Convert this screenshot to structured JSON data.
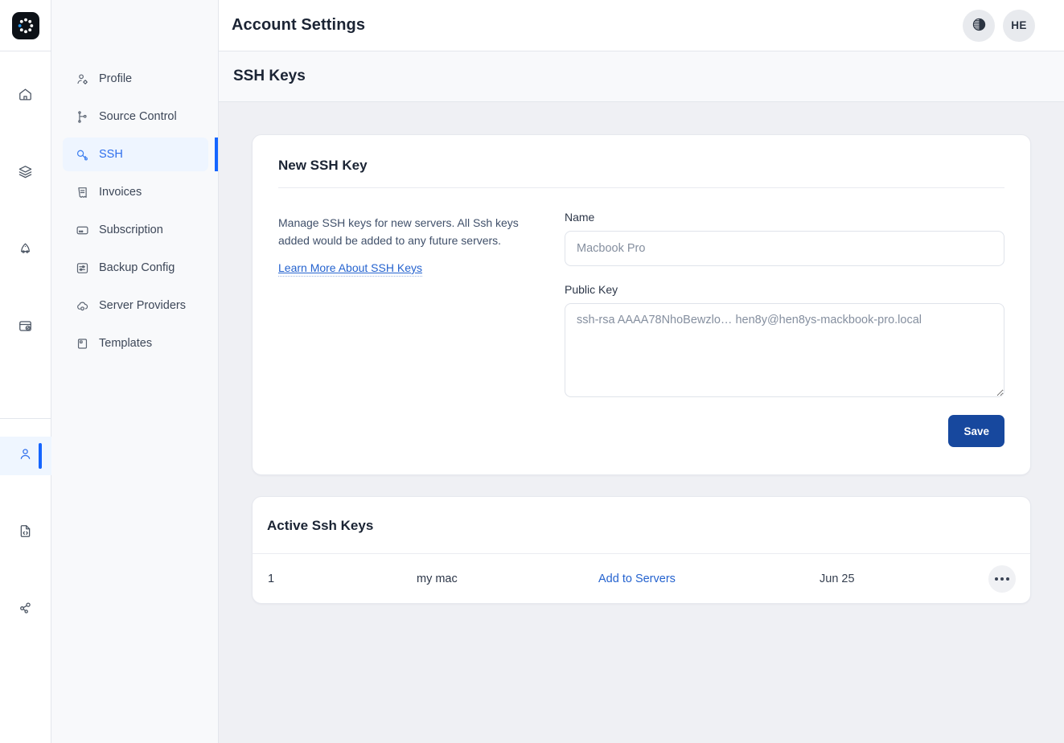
{
  "brand": {
    "logo_icon": "ring-of-dots-logo",
    "accent": "#1565ff",
    "accent_dark": "#17489e"
  },
  "topbar": {
    "title": "Account Settings",
    "theme_toggle_icon": "contrast-icon",
    "avatar_initials": "HE"
  },
  "rail": {
    "items": [
      {
        "name": "home",
        "icon": "home-icon",
        "active": false
      },
      {
        "name": "servers",
        "icon": "layers-icon",
        "active": false
      },
      {
        "name": "applications",
        "icon": "rocket-icon",
        "active": false
      },
      {
        "name": "backups",
        "icon": "database-check-icon",
        "active": false
      },
      {
        "name": "account",
        "icon": "user-icon",
        "active": true
      },
      {
        "name": "docs",
        "icon": "file-code-icon",
        "active": false
      },
      {
        "name": "integrations",
        "icon": "share-nodes-icon",
        "active": false
      }
    ]
  },
  "sidebar": {
    "items": [
      {
        "label": "Profile",
        "icon": "user-gear-icon",
        "active": false
      },
      {
        "label": "Source Control",
        "icon": "git-branch-icon",
        "active": false
      },
      {
        "label": "SSH",
        "icon": "key-icon",
        "active": true
      },
      {
        "label": "Invoices",
        "icon": "receipt-icon",
        "active": false
      },
      {
        "label": "Subscription",
        "icon": "credit-card-icon",
        "active": false
      },
      {
        "label": "Backup Config",
        "icon": "sliders-icon",
        "active": false
      },
      {
        "label": "Server Providers",
        "icon": "cloud-gear-icon",
        "active": false
      },
      {
        "label": "Templates",
        "icon": "template-icon",
        "active": false
      }
    ]
  },
  "panel": {
    "title": "SSH Keys"
  },
  "new_key_card": {
    "title": "New SSH Key",
    "description": "Manage SSH keys for new servers. All Ssh keys added would be added to any future servers.",
    "learn_more_label": "Learn More About SSH Keys",
    "name_label": "Name",
    "name_value": "",
    "name_placeholder": "Macbook Pro",
    "public_key_label": "Public Key",
    "public_key_value": "",
    "public_key_placeholder": "ssh-rsa AAAA78NhoBewzlo… hen8y@hen8ys-mackbook-pro.local",
    "save_label": "Save"
  },
  "active_keys_card": {
    "title": "Active Ssh Keys",
    "rows": [
      {
        "index": "1",
        "name": "my mac",
        "action_label": "Add to Servers",
        "date": "Jun 25",
        "menu_icon": "ellipsis-icon"
      }
    ]
  }
}
